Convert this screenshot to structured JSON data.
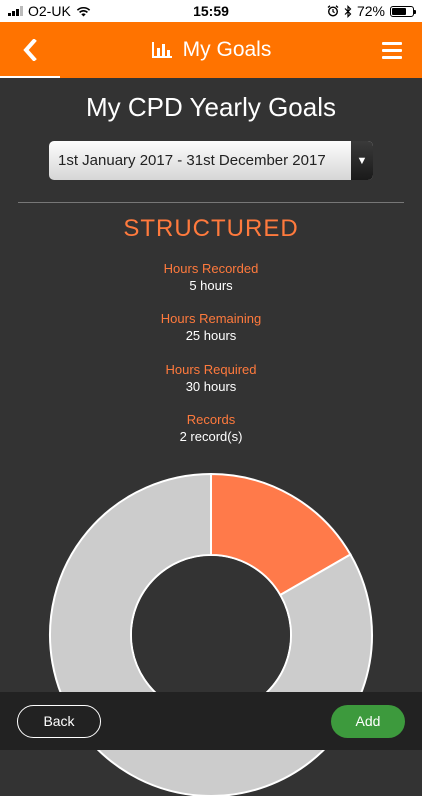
{
  "status_bar": {
    "carrier": "O2-UK",
    "time": "15:59",
    "battery_percent": "72%",
    "battery_level": 0.72,
    "icons": [
      "signal-icon",
      "wifi-icon",
      "alarm-icon",
      "bluetooth-icon",
      "battery-icon"
    ]
  },
  "nav": {
    "title": "My Goals",
    "icons": [
      "back-chevron-icon",
      "bar-chart-icon",
      "hamburger-menu-icon"
    ],
    "accent_color": "#ff7300"
  },
  "page": {
    "title": "My CPD Yearly Goals"
  },
  "period_select": {
    "selected": "1st January 2017 - 31st December 2017"
  },
  "section": {
    "title": "STRUCTURED",
    "title_color": "#ff7a3d"
  },
  "stats": [
    {
      "label": "Hours Recorded",
      "value": "5 hours"
    },
    {
      "label": "Hours Remaining",
      "value": "25 hours"
    },
    {
      "label": "Hours Required",
      "value": "30 hours"
    },
    {
      "label": "Records",
      "value": "2 record(s)"
    }
  ],
  "chart_data": {
    "type": "pie",
    "donut": true,
    "slices": [
      {
        "label": "Hours Recorded",
        "value": 5,
        "color": "#ff7a4a"
      },
      {
        "label": "Hours Remaining",
        "value": 25,
        "color": "#cccccc"
      }
    ]
  },
  "footer": {
    "back_label": "Back",
    "add_label": "Add",
    "add_color": "#3d9a3d"
  }
}
